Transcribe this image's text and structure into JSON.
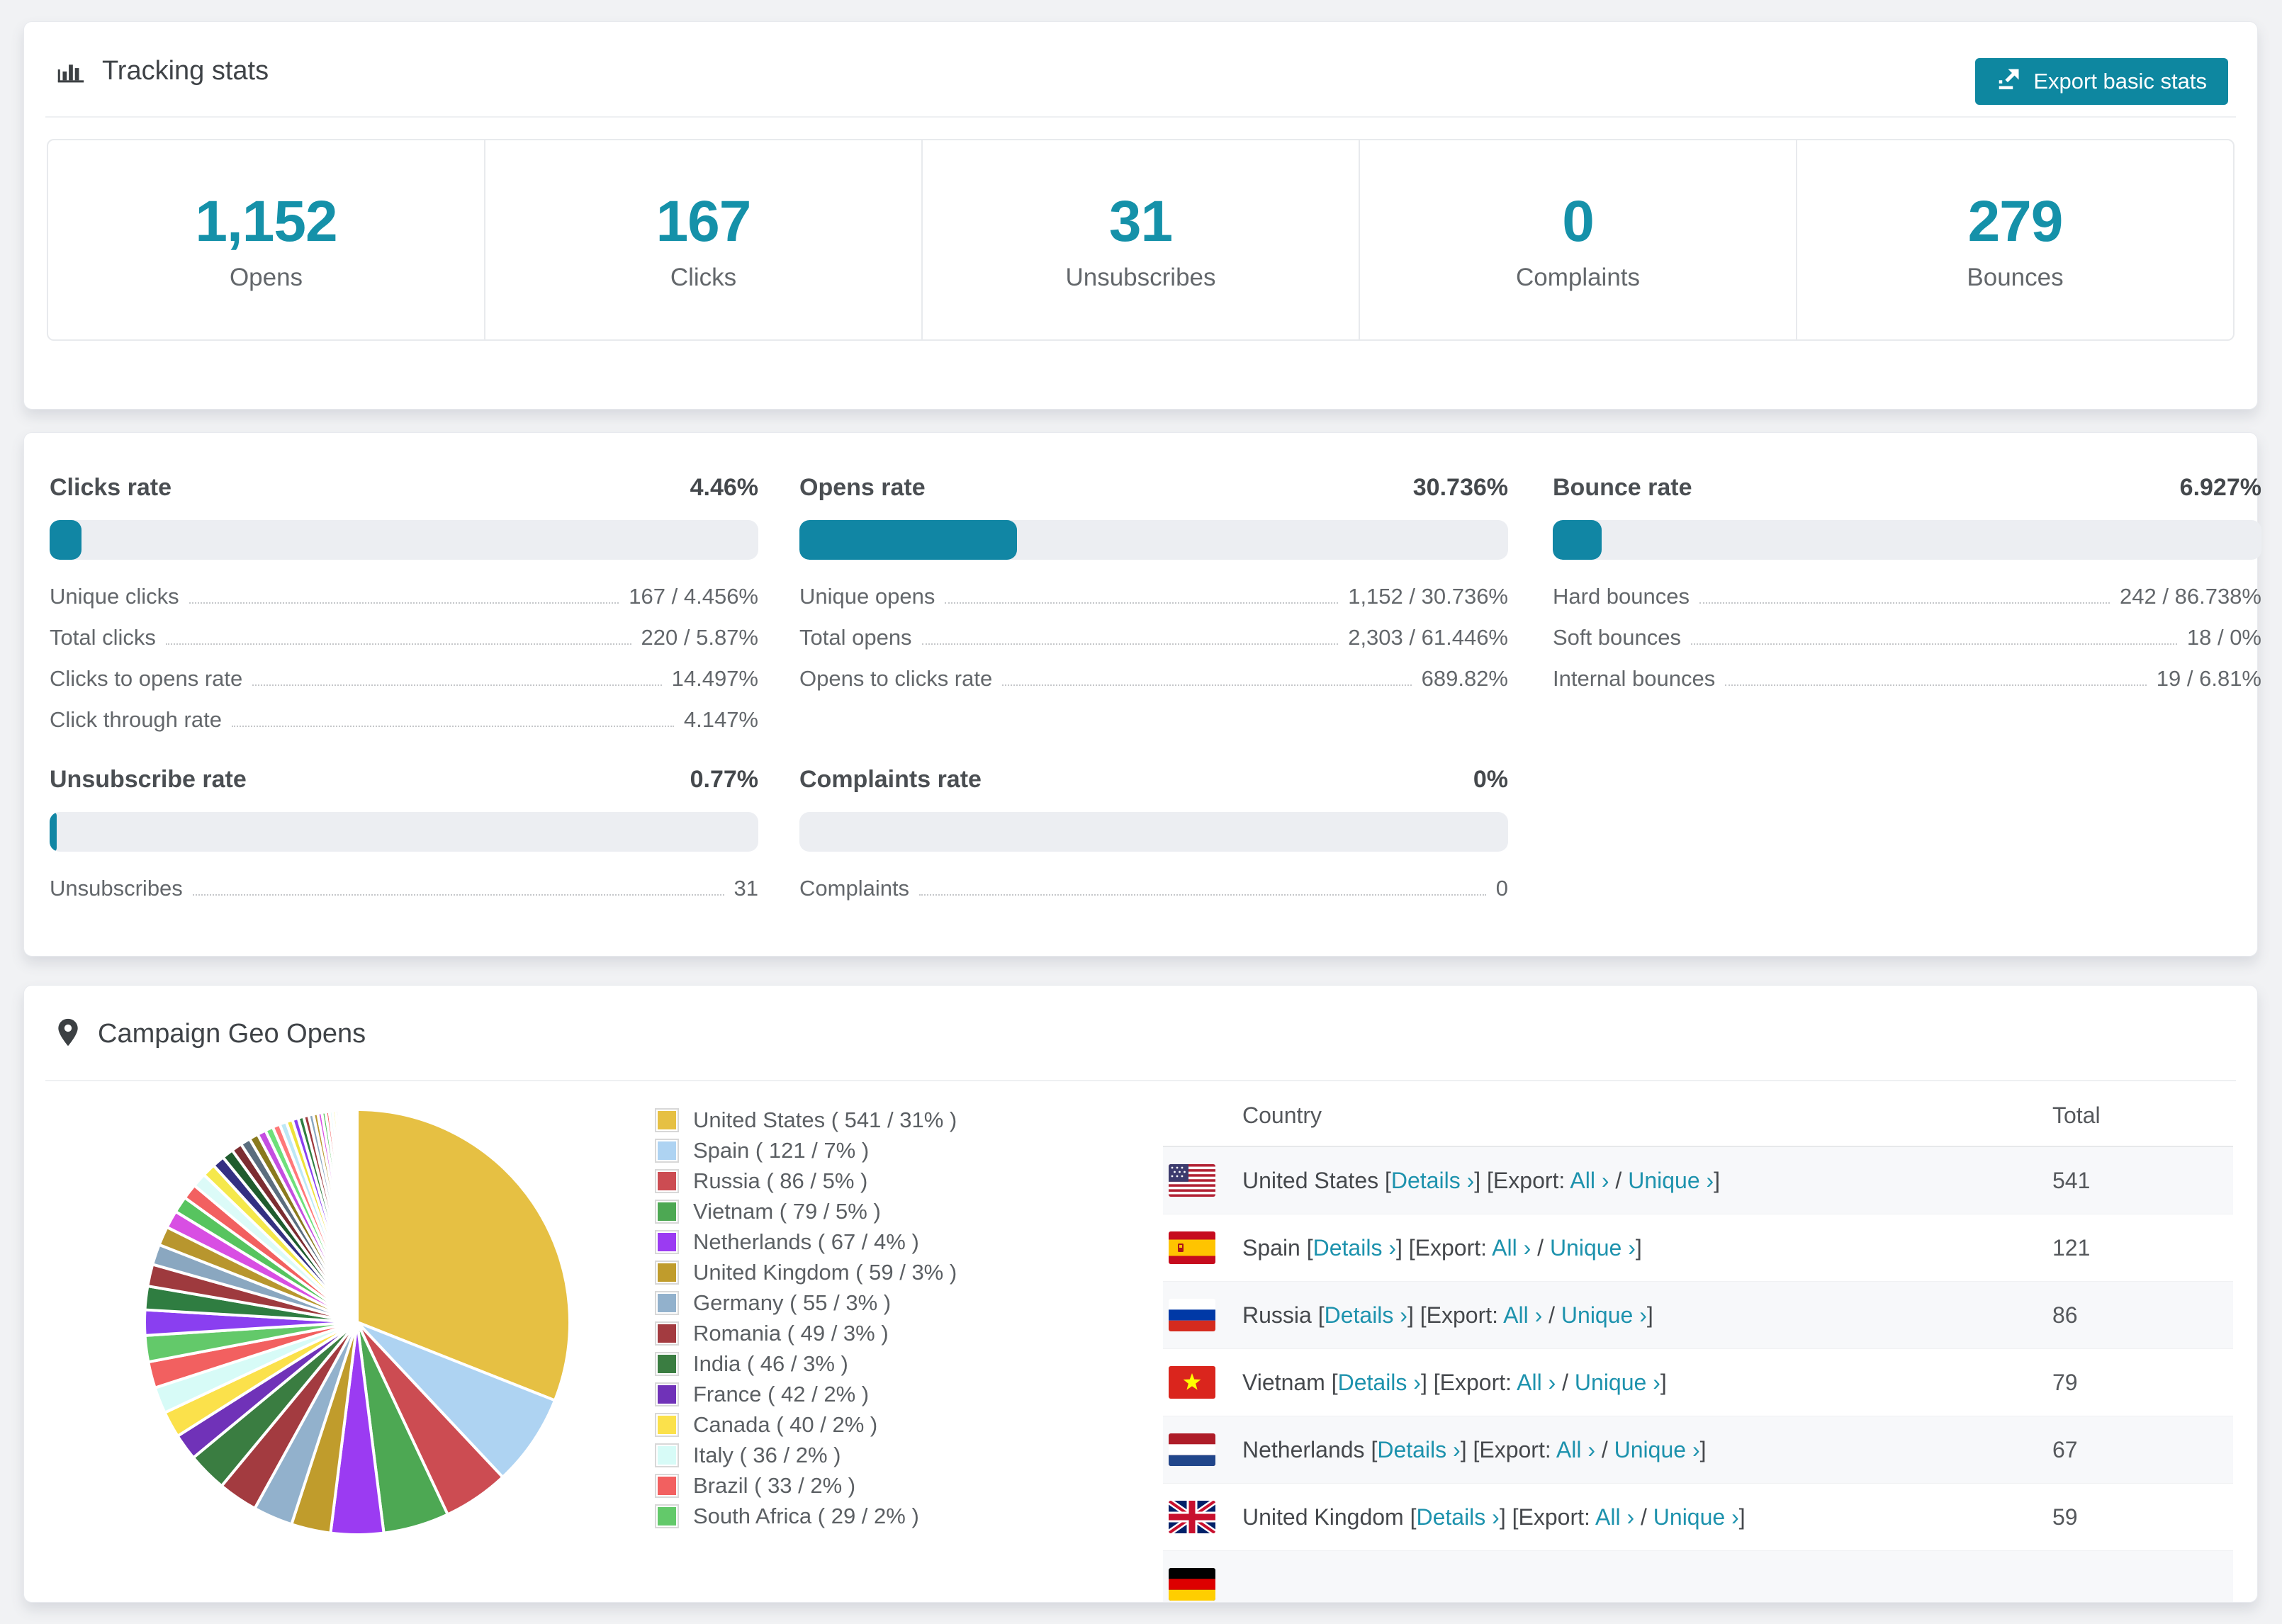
{
  "accent": {
    "teal": "#1591a9",
    "button_teal": "#0e87a0",
    "bar_fill": "#1186a4",
    "bar_track": "#eceef2",
    "link_teal": "#1d92ad"
  },
  "header": {
    "title": "Tracking stats",
    "icon": "bar-chart-icon",
    "export_label": "Export basic stats"
  },
  "summary_stats": [
    {
      "value": "1,152",
      "label": "Opens"
    },
    {
      "value": "167",
      "label": "Clicks"
    },
    {
      "value": "31",
      "label": "Unsubscribes"
    },
    {
      "value": "0",
      "label": "Complaints"
    },
    {
      "value": "279",
      "label": "Bounces"
    }
  ],
  "rates": [
    {
      "title": "Clicks rate",
      "value": "4.46%",
      "percent": 4.46,
      "col": 0,
      "row": 0,
      "rows": [
        [
          "Unique clicks",
          "167 / 4.456%"
        ],
        [
          "Total clicks",
          "220 / 5.87%"
        ],
        [
          "Clicks to opens rate",
          "14.497%"
        ],
        [
          "Click through rate",
          "4.147%"
        ]
      ]
    },
    {
      "title": "Opens rate",
      "value": "30.736%",
      "percent": 30.736,
      "col": 1,
      "row": 0,
      "rows": [
        [
          "Unique opens",
          "1,152 / 30.736%"
        ],
        [
          "Total opens",
          "2,303 / 61.446%"
        ],
        [
          "Opens to clicks rate",
          "689.82%"
        ]
      ]
    },
    {
      "title": "Bounce rate",
      "value": "6.927%",
      "percent": 6.927,
      "col": 2,
      "row": 0,
      "rows": [
        [
          "Hard bounces",
          "242 / 86.738%"
        ],
        [
          "Soft bounces",
          "18 / 0%"
        ],
        [
          "Internal bounces",
          "19 / 6.81%"
        ]
      ]
    },
    {
      "title": "Unsubscribe rate",
      "value": "0.77%",
      "percent": 0.77,
      "col": 0,
      "row": 1,
      "rows": [
        [
          "Unsubscribes",
          "31"
        ]
      ]
    },
    {
      "title": "Complaints rate",
      "value": "0%",
      "percent": 0,
      "col": 1,
      "row": 1,
      "rows": [
        [
          "Complaints",
          "0"
        ]
      ]
    }
  ],
  "geo": {
    "title": "Campaign Geo Opens",
    "icon": "map-pin-icon",
    "legend_format": "{label} ( {value} / {percent}% )",
    "table": {
      "columns": [
        "Country",
        "Total"
      ],
      "tokens": {
        "open": "[",
        "close": "]",
        "export_open": "[Export:",
        "slash": "/"
      },
      "links": {
        "details": "Details ›",
        "all": "All ›",
        "unique": "Unique ›"
      },
      "rows": [
        {
          "country": "United States",
          "flag": "us",
          "total": "541"
        },
        {
          "country": "Spain",
          "flag": "es",
          "total": "121"
        },
        {
          "country": "Russia",
          "flag": "ru",
          "total": "86"
        },
        {
          "country": "Vietnam",
          "flag": "vn",
          "total": "79"
        },
        {
          "country": "Netherlands",
          "flag": "nl",
          "total": "67"
        },
        {
          "country": "United Kingdom",
          "flag": "gb",
          "total": "59"
        }
      ],
      "partial_row": {
        "flag": "de"
      }
    }
  },
  "chart_data": {
    "type": "pie",
    "title": "Campaign Geo Opens",
    "unit": "opens",
    "legend_position": "right",
    "slices": [
      {
        "label": "United States",
        "value": 541,
        "percent": 31,
        "color": "#e6c043"
      },
      {
        "label": "Spain",
        "value": 121,
        "percent": 7,
        "color": "#aed3f2"
      },
      {
        "label": "Russia",
        "value": 86,
        "percent": 5,
        "color": "#cc4c52"
      },
      {
        "label": "Vietnam",
        "value": 79,
        "percent": 5,
        "color": "#4da853"
      },
      {
        "label": "Netherlands",
        "value": 67,
        "percent": 4,
        "color": "#9b3bf2"
      },
      {
        "label": "United Kingdom",
        "value": 59,
        "percent": 3,
        "color": "#c09c2c"
      },
      {
        "label": "Germany",
        "value": 55,
        "percent": 3,
        "color": "#92b1cc"
      },
      {
        "label": "Romania",
        "value": 49,
        "percent": 3,
        "color": "#a33b40"
      },
      {
        "label": "India",
        "value": 46,
        "percent": 3,
        "color": "#3a7d41"
      },
      {
        "label": "France",
        "value": 42,
        "percent": 2,
        "color": "#7032b8"
      },
      {
        "label": "Canada",
        "value": 40,
        "percent": 2,
        "color": "#fbe14b"
      },
      {
        "label": "Italy",
        "value": 36,
        "percent": 2,
        "color": "#d7fbf7"
      },
      {
        "label": "Brazil",
        "value": 33,
        "percent": 2,
        "color": "#f26060"
      },
      {
        "label": "South Africa",
        "value": 29,
        "percent": 2,
        "color": "#63c96a"
      }
    ],
    "others": {
      "total_percent": 26,
      "count": 40,
      "ratio": 0.93,
      "palette": [
        "#8a3ff0",
        "#2f7d41",
        "#9e3a3e",
        "#8aa7c0",
        "#b8962e",
        "#d84fe3",
        "#57c45f",
        "#f26060",
        "#dcfbf8",
        "#f5e84b",
        "#343082",
        "#1f5c2e",
        "#7c2d31",
        "#5b6d7e",
        "#8a7a1e",
        "#c44fe0",
        "#6ee07a",
        "#ff7878",
        "#bde8f5",
        "#efe13a"
      ]
    }
  }
}
